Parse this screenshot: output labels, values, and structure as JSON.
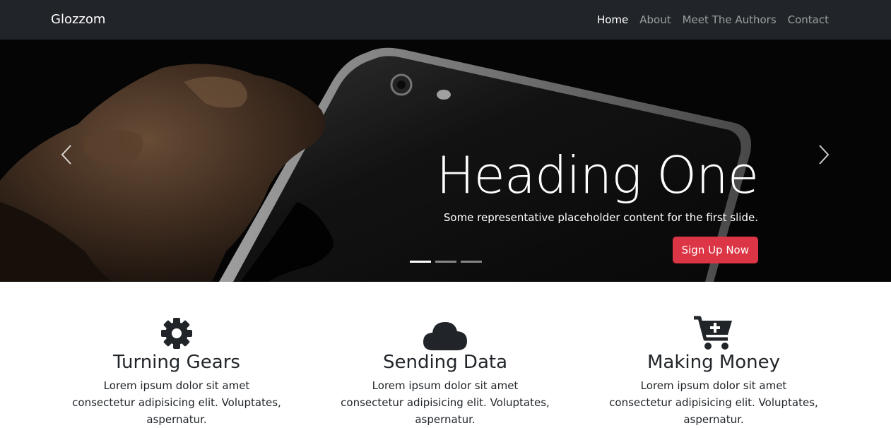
{
  "navbar": {
    "brand": "Glozzom",
    "links": [
      {
        "label": "Home",
        "active": true
      },
      {
        "label": "About",
        "active": false
      },
      {
        "label": "Meet The Authors",
        "active": false
      },
      {
        "label": "Contact",
        "active": false
      }
    ]
  },
  "carousel": {
    "heading": "Heading One",
    "text": "Some representative placeholder content for the first slide.",
    "button_label": "Sign Up Now",
    "indicators": [
      true,
      false,
      false
    ],
    "prev_icon": "chevron-left-icon",
    "next_icon": "chevron-right-icon"
  },
  "features": [
    {
      "icon": "gear-icon",
      "title": "Turning Gears",
      "text": "Lorem ipsum dolor sit amet consectetur adipisicing elit. Voluptates, aspernatur."
    },
    {
      "icon": "cloud-icon",
      "title": "Sending Data",
      "text": "Lorem ipsum dolor sit amet consectetur adipisicing elit. Voluptates, aspernatur."
    },
    {
      "icon": "cart-plus-icon",
      "title": "Making Money",
      "text": "Lorem ipsum dolor sit amet consectetur adipisicing elit. Voluptates, aspernatur."
    }
  ],
  "colors": {
    "navbar_bg": "#212529",
    "accent_button": "#dc3545",
    "icon_color": "#212529"
  }
}
